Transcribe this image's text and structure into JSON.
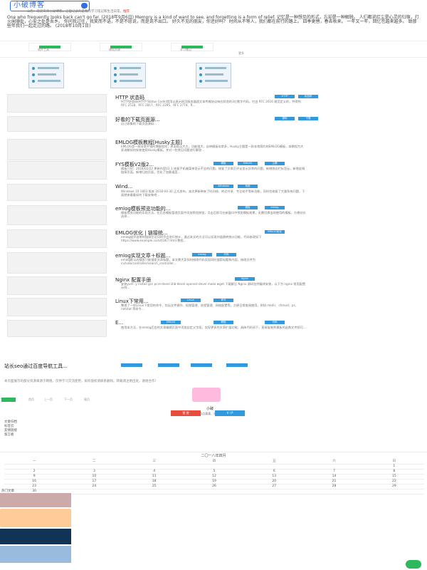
{
  "header": {
    "logo_text": "小破博客",
    "marquee_text": "公告：欢迎来到小破博客，这里记录的是我的学习笔记和生活日常，",
    "marquee_hot": "推荐"
  },
  "quote": {
    "text": "One who frequently looks back can't go far. (2018年9月6日) Memory is a kind of want to see, and forgetting is a form of relief. 记忆是一种想见的形式，忘却是一种解脱。 人们都说红尘是心灵的归宿，灯火阑珊处，心安之处是吾乡。 你问我过往，我笑而不语，不是不愿说，而是说不出口。 好久不见的朋友，你还好吗？ 时间从不等人，我们都在前行的路上。 四季更替，春去秋来。 一年又一年，回忆也越来越多。 致那些年我们一起走过的路。 (2018年10月1日)"
  },
  "quick_links": [
    {
      "label": "软件工具"
    },
    {
      "label": "建站资源"
    },
    {
      "label": "学习笔记"
    }
  ],
  "quick_more": "更多",
  "posts": [
    {
      "title": "HTTP 状态码",
      "tags": [
        "HTTP",
        "状态码"
      ],
      "excerpt": "HTTP状态码(HTTP Status Code)是用以表示网页服务器超文本传输协议响应状态的3位数字代码。它由 RFC 2616 规范定义的，并得到RFC 2518、RFC 2817、RFC 2295、RFC 2774、R..."
    },
    {
      "title": "好看的下载页面源...",
      "tags": [
        "源码",
        "下载"
      ],
      "excerpt": "自己收集的下载页面源码..."
    },
    {
      "title": "EMLOG模板教程[Husky主题]",
      "tags": [],
      "excerpt": "EMLOG是一款非常不错的博客程序，界面简洁大方，功能强大，自带模板非常多，Husky主题是一款非常简约的EMLOG模板，本教程为大家讲解如何安装使用Husky模板，并对一些常见问题进行解答..."
    },
    {
      "title": "FYS模板V2版2...",
      "tags": [
        "模板",
        "EMLOG",
        "主题"
      ],
      "excerpt": "模板介绍：2018/02/22 更新内容V2.1 修复手机端菜单显示不全的问题，修复了文章页评论显示异常的问题。新增侧边栏标签云，新增友情链接页面，新增归档页面，优化了加载速度..."
    },
    {
      "title": "Wind...",
      "tags": [
        "Windows",
        "系统"
      ],
      "excerpt": "Windows 10 1803 版本 2018-04-30 正式发布，本次更新带来了时间线、附近共享、专注助手等新功能，同时也修复了大量系统问题，下面就来看看如何下载安装吧..."
    },
    {
      "title": "emlog模板预览功能的...",
      "tags": [
        "emlog",
        "模板"
      ],
      "excerpt": "模板预览功能的实现方法，在后台模板管理页面中添加预览按钮，点击后即可在新窗口中预览模板效果，无需切换当前使用的模板，方便站长选择..."
    },
    {
      "title": "EMLOG优化 | 链接统...",
      "tags": [
        "EMLOG优化"
      ],
      "excerpt": "emlog程序自带的链接在访问时不会进行统计，通过本文的方法可以实现外链跳转统计功能，代码修改如下 https://www.example.com/t/367.html 教程..."
    },
    {
      "title": "emlog实现文章＋标题...",
      "tags": [
        "emlog",
        "代码"
      ],
      "excerpt": "emlog默认的搜索只能搜索文章标题，本文教大家如何修改代码实现同时搜索标题和内容，修改文件为 include/controller/search_controller..."
    },
    {
      "title": "Nginx 配置手册",
      "tags": [
        "Nginx"
      ],
      "excerpt": "安装yum -y install gcc pcre-devel zlib-devel openssl-devel make wget 下载解压 Nginx 源码包并编译安装，以下为 nginx 常用配置示例..."
    },
    {
      "title": "Linux下常用...",
      "tags": [
        "Linux",
        "命令"
      ],
      "excerpt": "整理了一些Linux下常用的命令，包括文件操作、权限管理、进程管理、网络配置等，方便日常查阅使用，例如 mkdir、chmod、ps、netstat 等命令..."
    },
    {
      "title": "E...",
      "tags": [
        "EMLOG",
        "教程",
        "代码"
      ],
      "excerpt": "使用本方法，在emlog后台的文章编辑页面中添加自定义字段，实现更多的文章扩展功能，具体代码如下，直接复制到模板的函数文件即可..."
    }
  ],
  "wide_post": {
    "title": "站长seo通过百度导航工具..."
  },
  "notice": "本页面展示的部分资源来源于网络，仅供学习交流使用，如有侵权请联系删除。转载请注明出处，谢谢合作！",
  "pager": {
    "first": "首页",
    "prev": "上一页",
    "next": "下一页",
    "last": "尾页"
  },
  "author": {
    "name": "小破",
    "sign": "记录生活的点点滴滴，分享学习的知识。",
    "btn_sponsor": "赞 赏",
    "btn_vip": "V I P"
  },
  "side_list": [
    "文章归档",
    "标签云",
    "友情链接",
    "留言板"
  ],
  "calendar": {
    "title": "二〇一八年四月",
    "weekdays": [
      "一",
      "二",
      "三",
      "四",
      "五",
      "六",
      "日"
    ],
    "rows": [
      [
        "",
        "",
        "",
        "",
        "",
        "",
        "1"
      ],
      [
        "2",
        "3",
        "4",
        "5",
        "6",
        "7",
        "8"
      ],
      [
        "9",
        "10",
        "11",
        "12",
        "13",
        "14",
        "15"
      ],
      [
        "16",
        "17",
        "18",
        "19",
        "20",
        "21",
        "22"
      ],
      [
        "23",
        "24",
        "25",
        "26",
        "27",
        "28",
        "29"
      ],
      [
        "30",
        "",
        "",
        "",
        "",
        "",
        ""
      ]
    ]
  },
  "side_caption": "热门文章",
  "colors": {
    "accent": "#3399dd",
    "green": "#2eb85c",
    "red": "#e74c3c"
  }
}
